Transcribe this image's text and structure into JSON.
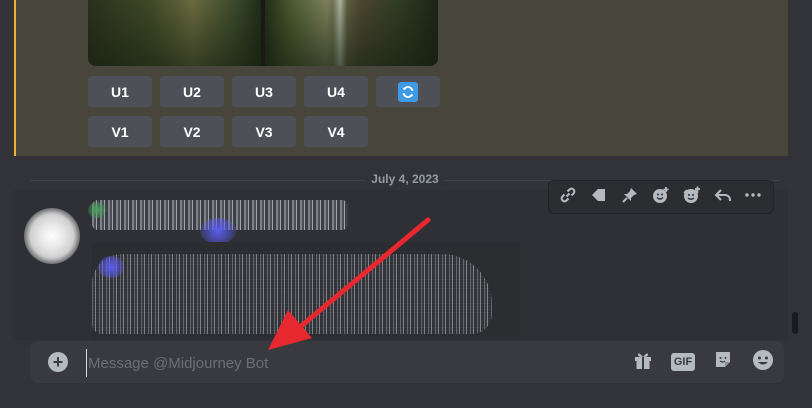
{
  "midjourney": {
    "upscale_buttons": [
      "U1",
      "U2",
      "U3",
      "U4"
    ],
    "variation_buttons": [
      "V1",
      "V2",
      "V3",
      "V4"
    ],
    "reroll_icon": "reroll-icon"
  },
  "divider": {
    "date": "July 4, 2023"
  },
  "toolbar": {
    "icons": [
      "link-icon",
      "tag-icon",
      "pin-icon",
      "add-reaction-icon",
      "add-super-reaction-icon",
      "reply-icon",
      "more-icon"
    ]
  },
  "composer": {
    "placeholder": "Message @Midjourney Bot",
    "gif_label": "GIF",
    "icons": [
      "add-icon",
      "gift-icon",
      "gif-icon",
      "sticker-icon",
      "emoji-icon"
    ]
  },
  "colors": {
    "mention_highlight": "#f0b232",
    "annotation_arrow": "#e8282f",
    "reroll_blue": "#3f9ae6"
  }
}
